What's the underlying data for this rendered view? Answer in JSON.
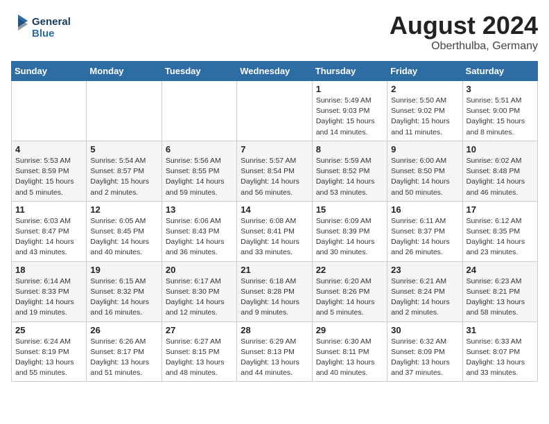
{
  "header": {
    "logo_line1": "General",
    "logo_line2": "Blue",
    "month_year": "August 2024",
    "location": "Oberthulba, Germany"
  },
  "weekdays": [
    "Sunday",
    "Monday",
    "Tuesday",
    "Wednesday",
    "Thursday",
    "Friday",
    "Saturday"
  ],
  "weeks": [
    [
      {
        "day": "",
        "info": ""
      },
      {
        "day": "",
        "info": ""
      },
      {
        "day": "",
        "info": ""
      },
      {
        "day": "",
        "info": ""
      },
      {
        "day": "1",
        "info": "Sunrise: 5:49 AM\nSunset: 9:03 PM\nDaylight: 15 hours\nand 14 minutes."
      },
      {
        "day": "2",
        "info": "Sunrise: 5:50 AM\nSunset: 9:02 PM\nDaylight: 15 hours\nand 11 minutes."
      },
      {
        "day": "3",
        "info": "Sunrise: 5:51 AM\nSunset: 9:00 PM\nDaylight: 15 hours\nand 8 minutes."
      }
    ],
    [
      {
        "day": "4",
        "info": "Sunrise: 5:53 AM\nSunset: 8:59 PM\nDaylight: 15 hours\nand 5 minutes."
      },
      {
        "day": "5",
        "info": "Sunrise: 5:54 AM\nSunset: 8:57 PM\nDaylight: 15 hours\nand 2 minutes."
      },
      {
        "day": "6",
        "info": "Sunrise: 5:56 AM\nSunset: 8:55 PM\nDaylight: 14 hours\nand 59 minutes."
      },
      {
        "day": "7",
        "info": "Sunrise: 5:57 AM\nSunset: 8:54 PM\nDaylight: 14 hours\nand 56 minutes."
      },
      {
        "day": "8",
        "info": "Sunrise: 5:59 AM\nSunset: 8:52 PM\nDaylight: 14 hours\nand 53 minutes."
      },
      {
        "day": "9",
        "info": "Sunrise: 6:00 AM\nSunset: 8:50 PM\nDaylight: 14 hours\nand 50 minutes."
      },
      {
        "day": "10",
        "info": "Sunrise: 6:02 AM\nSunset: 8:48 PM\nDaylight: 14 hours\nand 46 minutes."
      }
    ],
    [
      {
        "day": "11",
        "info": "Sunrise: 6:03 AM\nSunset: 8:47 PM\nDaylight: 14 hours\nand 43 minutes."
      },
      {
        "day": "12",
        "info": "Sunrise: 6:05 AM\nSunset: 8:45 PM\nDaylight: 14 hours\nand 40 minutes."
      },
      {
        "day": "13",
        "info": "Sunrise: 6:06 AM\nSunset: 8:43 PM\nDaylight: 14 hours\nand 36 minutes."
      },
      {
        "day": "14",
        "info": "Sunrise: 6:08 AM\nSunset: 8:41 PM\nDaylight: 14 hours\nand 33 minutes."
      },
      {
        "day": "15",
        "info": "Sunrise: 6:09 AM\nSunset: 8:39 PM\nDaylight: 14 hours\nand 30 minutes."
      },
      {
        "day": "16",
        "info": "Sunrise: 6:11 AM\nSunset: 8:37 PM\nDaylight: 14 hours\nand 26 minutes."
      },
      {
        "day": "17",
        "info": "Sunrise: 6:12 AM\nSunset: 8:35 PM\nDaylight: 14 hours\nand 23 minutes."
      }
    ],
    [
      {
        "day": "18",
        "info": "Sunrise: 6:14 AM\nSunset: 8:33 PM\nDaylight: 14 hours\nand 19 minutes."
      },
      {
        "day": "19",
        "info": "Sunrise: 6:15 AM\nSunset: 8:32 PM\nDaylight: 14 hours\nand 16 minutes."
      },
      {
        "day": "20",
        "info": "Sunrise: 6:17 AM\nSunset: 8:30 PM\nDaylight: 14 hours\nand 12 minutes."
      },
      {
        "day": "21",
        "info": "Sunrise: 6:18 AM\nSunset: 8:28 PM\nDaylight: 14 hours\nand 9 minutes."
      },
      {
        "day": "22",
        "info": "Sunrise: 6:20 AM\nSunset: 8:26 PM\nDaylight: 14 hours\nand 5 minutes."
      },
      {
        "day": "23",
        "info": "Sunrise: 6:21 AM\nSunset: 8:24 PM\nDaylight: 14 hours\nand 2 minutes."
      },
      {
        "day": "24",
        "info": "Sunrise: 6:23 AM\nSunset: 8:21 PM\nDaylight: 13 hours\nand 58 minutes."
      }
    ],
    [
      {
        "day": "25",
        "info": "Sunrise: 6:24 AM\nSunset: 8:19 PM\nDaylight: 13 hours\nand 55 minutes."
      },
      {
        "day": "26",
        "info": "Sunrise: 6:26 AM\nSunset: 8:17 PM\nDaylight: 13 hours\nand 51 minutes."
      },
      {
        "day": "27",
        "info": "Sunrise: 6:27 AM\nSunset: 8:15 PM\nDaylight: 13 hours\nand 48 minutes."
      },
      {
        "day": "28",
        "info": "Sunrise: 6:29 AM\nSunset: 8:13 PM\nDaylight: 13 hours\nand 44 minutes."
      },
      {
        "day": "29",
        "info": "Sunrise: 6:30 AM\nSunset: 8:11 PM\nDaylight: 13 hours\nand 40 minutes."
      },
      {
        "day": "30",
        "info": "Sunrise: 6:32 AM\nSunset: 8:09 PM\nDaylight: 13 hours\nand 37 minutes."
      },
      {
        "day": "31",
        "info": "Sunrise: 6:33 AM\nSunset: 8:07 PM\nDaylight: 13 hours\nand 33 minutes."
      }
    ]
  ]
}
